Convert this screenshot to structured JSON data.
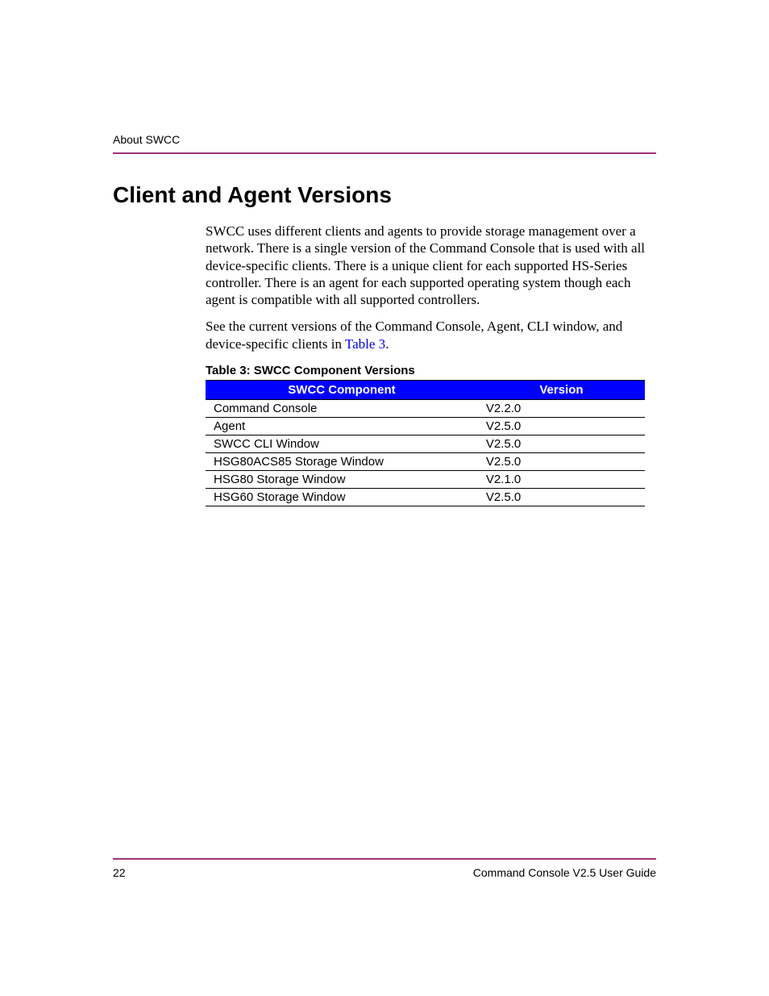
{
  "header": {
    "label": "About SWCC"
  },
  "heading": "Client and Agent Versions",
  "paragraphs": {
    "p1": "SWCC uses different clients and agents to provide storage management over a network. There is a single version of the Command Console that is used with all device-specific clients. There is a unique client for each supported HS-Series controller. There is an agent for each supported operating system though each agent is compatible with all supported controllers.",
    "p2_a": "See the current versions of the Command Console, Agent, CLI window, and device-specific clients in ",
    "p2_link": "Table 3",
    "p2_b": "."
  },
  "table": {
    "caption": "Table 3:  SWCC Component Versions",
    "headers": {
      "component": "SWCC Component",
      "version": "Version"
    },
    "rows": [
      {
        "component": "Command Console",
        "version": "V2.2.0"
      },
      {
        "component": "Agent",
        "version": "V2.5.0"
      },
      {
        "component": "SWCC CLI Window",
        "version": "V2.5.0"
      },
      {
        "component": "HSG80ACS85 Storage Window",
        "version": "V2.5.0"
      },
      {
        "component": "HSG80 Storage Window",
        "version": "V2.1.0"
      },
      {
        "component": "HSG60 Storage Window",
        "version": "V2.5.0"
      }
    ]
  },
  "footer": {
    "page": "22",
    "title": "Command Console V2.5 User Guide"
  }
}
